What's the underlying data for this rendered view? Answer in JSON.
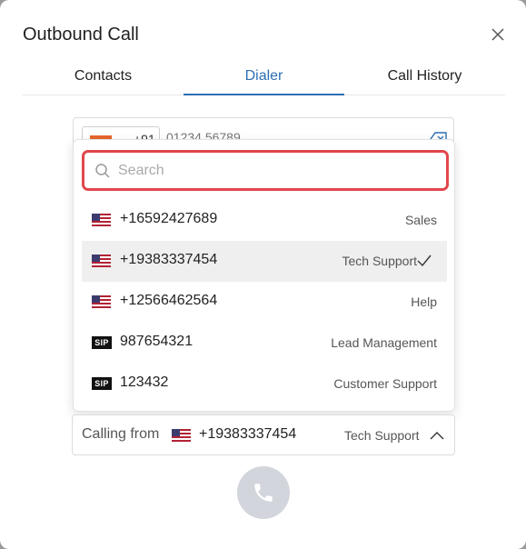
{
  "dialog": {
    "title": "Outbound Call"
  },
  "tabs": [
    {
      "label": "Contacts"
    },
    {
      "label": "Dialer",
      "active": true
    },
    {
      "label": "Call History"
    }
  ],
  "dialer": {
    "country_code": "+91",
    "phone_placeholder": "01234 56789"
  },
  "search": {
    "placeholder": "Search",
    "value": ""
  },
  "caller_ids": [
    {
      "type": "us",
      "number": "+16592427689",
      "label": "Sales"
    },
    {
      "type": "us",
      "number": "+19383337454",
      "label": "Tech Support",
      "selected": true
    },
    {
      "type": "us",
      "number": "+12566462564",
      "label": "Help"
    },
    {
      "type": "sip",
      "badge": "SIP",
      "number": "987654321",
      "label": "Lead Management"
    },
    {
      "type": "sip",
      "badge": "SIP",
      "number": "123432",
      "label": "Customer Support"
    }
  ],
  "calling_from": {
    "label": "Calling from",
    "number": "+19383337454",
    "name": "Tech Support"
  },
  "colors": {
    "accent": "#2d6fb4",
    "search_focus": "#e0474c",
    "call_button": "#d2d5dc",
    "selected_row": "#efeff0"
  }
}
